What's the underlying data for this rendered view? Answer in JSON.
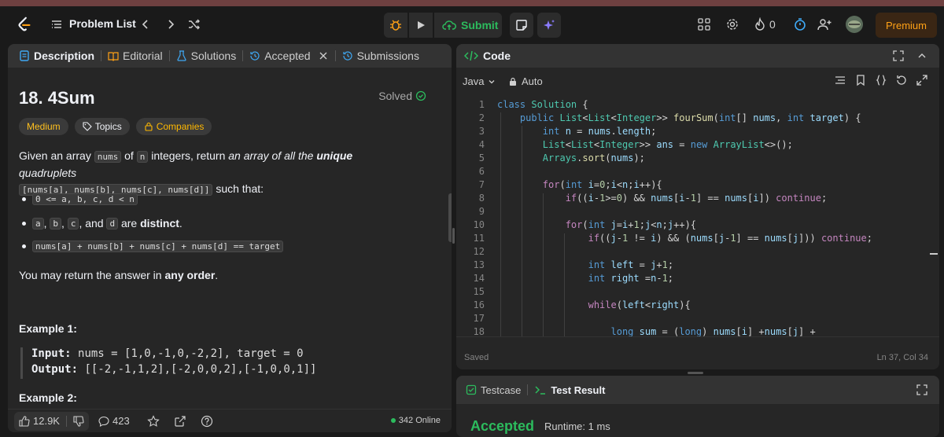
{
  "nav": {
    "title": "Problem List",
    "submit_label": "Submit",
    "streak_count": "0",
    "premium_label": "Premium"
  },
  "left_panel": {
    "tabs": [
      {
        "label": "Description"
      },
      {
        "label": "Editorial"
      },
      {
        "label": "Solutions"
      },
      {
        "label": "Accepted"
      },
      {
        "label": "Submissions"
      }
    ],
    "problem_title": "18. 4Sum",
    "solved_label": "Solved",
    "tags": {
      "difficulty": "Medium",
      "topics": "Topics",
      "companies": "Companies"
    },
    "description": {
      "p1_a": "Given an array",
      "p1_nums": "nums",
      "p1_b": "of",
      "p1_n": "n",
      "p1_c": "integers, return",
      "p1_d": "an array of all the",
      "p1_unique": "unique",
      "p1_e": "quadruplets",
      "p1_code": "[nums[a], nums[b], nums[c], nums[d]]",
      "p1_f": "such that:",
      "bullet1": "0 <= a, b, c, d < n",
      "bullet2_a": "a",
      "bullet2_b": "b",
      "bullet2_c": "c",
      "bullet2_and": ", and",
      "bullet2_d": "d",
      "bullet2_are": "are",
      "bullet2_distinct": "distinct",
      "bullet3": "nums[a] + nums[b] + nums[c] + nums[d] == target",
      "p2_a": "You may return the answer in",
      "p2_b": "any order",
      "p2_c": "."
    },
    "example1": {
      "title": "Example 1:",
      "input_label": "Input:",
      "input_value": "nums = [1,0,-1,0,-2,2], target = 0",
      "output_label": "Output:",
      "output_value": "[[-2,-1,1,2],[-2,0,0,2],[-1,0,0,1]]"
    },
    "example2_title": "Example 2:",
    "footer": {
      "likes": "12.9K",
      "comments": "423",
      "online": "342 Online"
    }
  },
  "code_panel": {
    "title": "Code",
    "language": "Java",
    "mode": "Auto",
    "line_numbers": [
      "1",
      "2",
      "3",
      "4",
      "5",
      "6",
      "7",
      "8",
      "9",
      "10",
      "11",
      "12",
      "13",
      "14",
      "15",
      "16",
      "17",
      "18"
    ],
    "saved_label": "Saved",
    "cursor": "Ln 37, Col 34"
  },
  "bottom_panel": {
    "tab_testcase": "Testcase",
    "tab_result": "Test Result",
    "status": "Accepted",
    "runtime": "Runtime: 1 ms"
  },
  "colors": {
    "accent": "#ffa116",
    "success": "#2cbb5d",
    "medium": "#ffc01e"
  }
}
